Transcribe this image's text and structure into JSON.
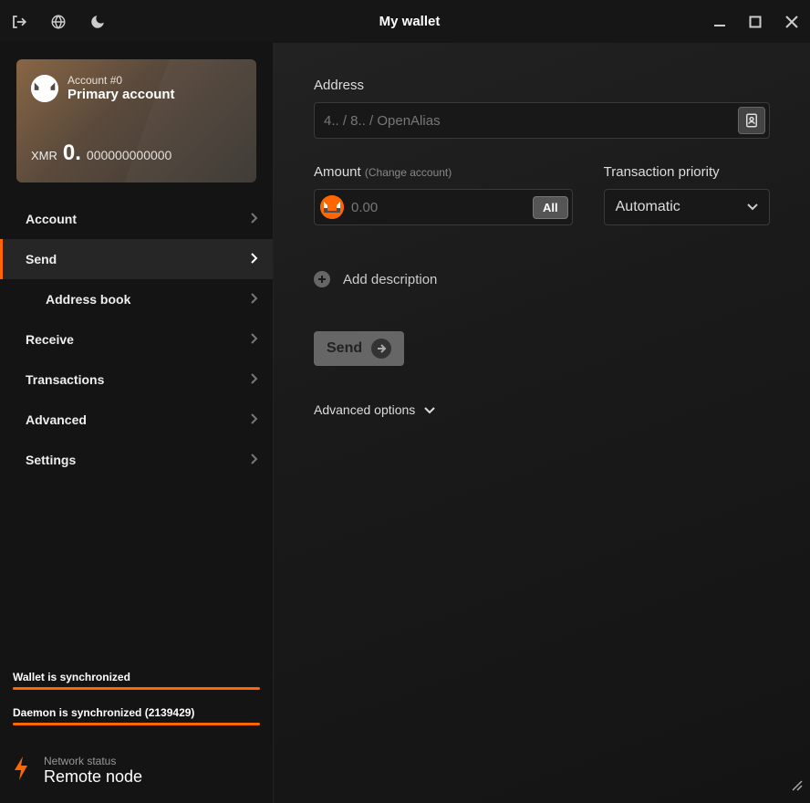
{
  "titlebar": {
    "title": "My wallet"
  },
  "account_card": {
    "account_label": "Account #0",
    "account_name": "Primary account",
    "currency": "XMR",
    "balance_int": "0.",
    "balance_dec": "000000000000"
  },
  "nav": {
    "account": "Account",
    "send": "Send",
    "address_book": "Address book",
    "receive": "Receive",
    "transactions": "Transactions",
    "advanced": "Advanced",
    "settings": "Settings"
  },
  "sync": {
    "wallet_label": "Wallet is synchronized",
    "daemon_label": "Daemon is synchronized (2139429)"
  },
  "network": {
    "label": "Network status",
    "value": "Remote node"
  },
  "send_form": {
    "address_label": "Address",
    "address_placeholder": "4.. / 8.. / OpenAlias",
    "amount_label": "Amount",
    "change_account": "(Change account)",
    "amount_placeholder": "0.00",
    "all_btn": "All",
    "priority_label": "Transaction priority",
    "priority_value": "Automatic",
    "add_description": "Add description",
    "send_button": "Send",
    "advanced_options": "Advanced options"
  }
}
